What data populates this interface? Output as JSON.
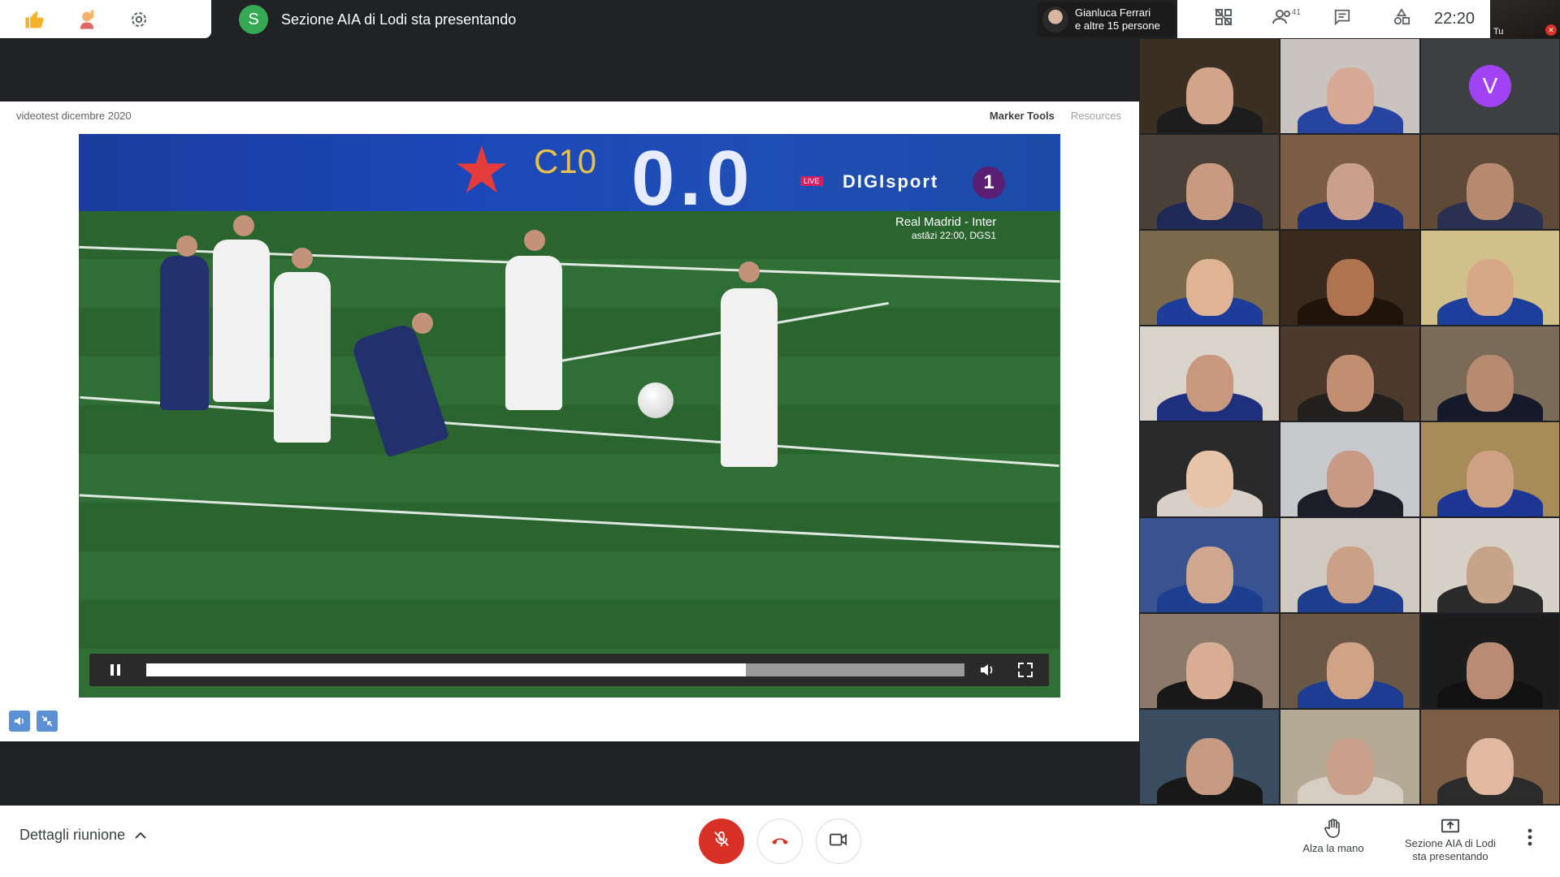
{
  "app": {
    "presenter_initial": "S",
    "presenting_title": "Sezione AIA di Lodi sta presentando",
    "clock": "22:20"
  },
  "top_left": {
    "icons": [
      "thumbs-up-icon",
      "raise-hand-emoji-icon",
      "settings-icon"
    ]
  },
  "top_right": {
    "people_line1": "Gianluca Ferrari",
    "people_line2": "e altre 15 persone",
    "participants_count": "41",
    "self_label": "Tu"
  },
  "slide": {
    "header": "videotest dicembre 2020",
    "links": [
      "Marker Tools",
      "Resources"
    ]
  },
  "video": {
    "score": "0.0",
    "code": "C10",
    "brand": "DIGIsport",
    "live": "LIVE",
    "channel": "1",
    "match": "Real Madrid - Inter",
    "match_time": "astăzi 22:00, DGS1",
    "progress": 0.733
  },
  "grid": {
    "avatar_initial": "V",
    "tiles": [
      {
        "bg": "#3b2e22",
        "face": "#d2a48a",
        "body": "#1d1d1d"
      },
      {
        "bg": "#c9c4bf",
        "face": "#d7a893",
        "body": "#2745a0"
      },
      {
        "bg": "#3c4043",
        "avatar": true
      },
      {
        "bg": "#4a4038",
        "face": "#c89a80",
        "body": "#1e2a55"
      },
      {
        "bg": "#7b5c45",
        "face": "#caa08a",
        "body": "#1d2f7a"
      },
      {
        "bg": "#5e4a36",
        "face": "#b58a6e",
        "body": "#2a3050"
      },
      {
        "bg": "#7a6a4b",
        "face": "#e0b395",
        "body": "#1e3c99"
      },
      {
        "bg": "#3a2a1e",
        "face": "#b07350",
        "body": "#20130a"
      },
      {
        "bg": "#d2c08a",
        "face": "#d7a887",
        "body": "#1d3f9c"
      },
      {
        "bg": "#d9d3cb",
        "face": "#c7987e",
        "body": "#1e2f7e"
      },
      {
        "bg": "#4b3a2c",
        "face": "#c28e72",
        "body": "#22201e"
      },
      {
        "bg": "#7a6a58",
        "face": "#b88a70",
        "body": "#151a2a"
      },
      {
        "bg": "#2a2a2a",
        "face": "#e7c4a7",
        "body": "#d8d0c8"
      },
      {
        "bg": "#c7c9cc",
        "face": "#c89a83",
        "body": "#1b1e28"
      },
      {
        "bg": "#a88c58",
        "face": "#cfa185",
        "body": "#1d3693"
      },
      {
        "bg": "#38538f",
        "face": "#cfa78e",
        "body": "#1e3f8f"
      },
      {
        "bg": "#cfc9c2",
        "face": "#caa087",
        "body": "#1e3d8c"
      },
      {
        "bg": "#d8d1c7",
        "face": "#c7a38a",
        "body": "#2a2a2a"
      },
      {
        "bg": "#8b7a6a",
        "face": "#d8ad93",
        "body": "#181818"
      },
      {
        "bg": "#6a5846",
        "face": "#d0a286",
        "body": "#1d3c93"
      },
      {
        "bg": "#1c1c1c",
        "face": "#b88b72",
        "body": "#111111"
      },
      {
        "bg": "#3a4d60",
        "face": "#c79a82",
        "body": "#181818"
      },
      {
        "bg": "#b5aa95",
        "face": "#caa08a",
        "body": "#d6cec3"
      },
      {
        "bg": "#7b5e45",
        "face": "#e0b9a0",
        "body": "#2b2b2b"
      }
    ]
  },
  "bottom_bar": {
    "meeting_details": "Dettagli riunione",
    "raise_hand": "Alza la mano",
    "present_line1": "Sezione AIA di Lodi",
    "present_line2": "sta presentando"
  },
  "colors": {
    "danger": "#d93025",
    "presenter_green": "#34a853",
    "avatar_purple": "#a142f4"
  }
}
